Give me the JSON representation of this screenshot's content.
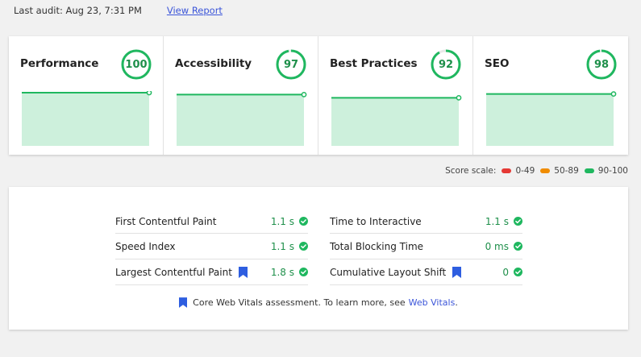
{
  "audit": {
    "last_audit": "Last audit: Aug 23, 7:31 PM",
    "view_report": "View Report"
  },
  "score_cards": [
    {
      "title": "Performance",
      "score": "100",
      "fraction": 1.0,
      "trend": [
        1.0,
        1.0,
        1.0,
        1.0
      ]
    },
    {
      "title": "Accessibility",
      "score": "97",
      "fraction": 0.97,
      "trend": [
        0.97,
        0.97,
        0.97,
        0.97
      ]
    },
    {
      "title": "Best Practices",
      "score": "92",
      "fraction": 0.92,
      "trend": [
        0.92,
        0.92,
        0.92,
        0.92
      ]
    },
    {
      "title": "SEO",
      "score": "98",
      "fraction": 0.98,
      "trend": [
        0.98,
        0.98,
        0.98,
        0.98
      ]
    }
  ],
  "colors": {
    "good": "#1fb75f",
    "good_fill": "#cdf0dc",
    "average": "#f08c00",
    "poor": "#e53935",
    "link": "#3b55d9",
    "bookmark": "#2e5ee0"
  },
  "score_scale": {
    "label": "Score scale:",
    "ranges": [
      {
        "text": "0-49",
        "color": "#e53935"
      },
      {
        "text": "50-89",
        "color": "#f08c00"
      },
      {
        "text": "90-100",
        "color": "#1fb75f"
      }
    ]
  },
  "metrics": {
    "left": [
      {
        "label": "First Contentful Paint",
        "value": "1.1 s",
        "core": false
      },
      {
        "label": "Speed Index",
        "value": "1.1 s",
        "core": false
      },
      {
        "label": "Largest Contentful Paint",
        "value": "1.8 s",
        "core": true
      }
    ],
    "right": [
      {
        "label": "Time to Interactive",
        "value": "1.1 s",
        "core": false
      },
      {
        "label": "Total Blocking Time",
        "value": "0 ms",
        "core": false
      },
      {
        "label": "Cumulative Layout Shift",
        "value": "0",
        "core": true
      }
    ]
  },
  "footer": {
    "text": "Core Web Vitals assessment. To learn more, see",
    "link": "Web Vitals",
    "period": "."
  },
  "icons": {
    "pass": "check-circle-icon",
    "core_vital": "bookmark-icon"
  }
}
